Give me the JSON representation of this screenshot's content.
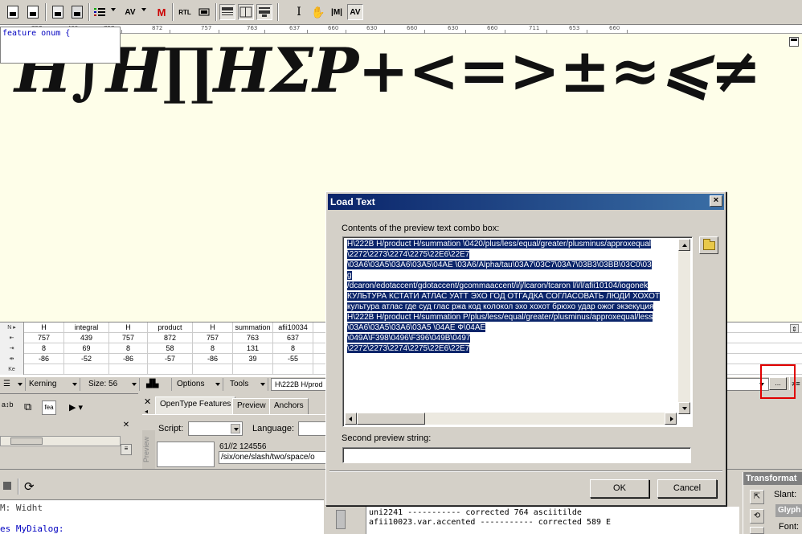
{
  "preview": {
    "glyph_text": "H∫H∏HΣP+<=>±≈⩽≠"
  },
  "ruler": {
    "values": [
      "757",
      "439",
      "757",
      "872",
      "757",
      "763",
      "637",
      "660",
      "630",
      "660",
      "630",
      "660",
      "711",
      "653",
      "660"
    ]
  },
  "metrics": {
    "row_labels": [
      "N ▸",
      "⇤",
      "⇥",
      "⇹",
      "Ke"
    ],
    "columns": [
      {
        "name": "H",
        "advance": "757",
        "lsb": "8",
        "rsb": "-86"
      },
      {
        "name": "integral",
        "advance": "439",
        "lsb": "69",
        "rsb": "-52"
      },
      {
        "name": "H",
        "advance": "757",
        "lsb": "8",
        "rsb": "-86"
      },
      {
        "name": "product",
        "advance": "872",
        "lsb": "58",
        "rsb": "-57"
      },
      {
        "name": "H",
        "advance": "757",
        "lsb": "8",
        "rsb": "-86"
      },
      {
        "name": "summation",
        "advance": "763",
        "lsb": "131",
        "rsb": "39"
      },
      {
        "name": "afii10034",
        "advance": "637",
        "lsb": "8",
        "rsb": "-55"
      }
    ]
  },
  "bar2": {
    "kerning": "Kerning",
    "size": "Size: 56",
    "options": "Options",
    "tools": "Tools",
    "combo_value": "H\\222B H/prod",
    "ellipsis": "...",
    "ne": "≠≡"
  },
  "lower_left": {
    "code_line": "feature onum {"
  },
  "ot_panel": {
    "tabs": [
      "OpenType Features",
      "Preview",
      "Anchors"
    ],
    "script_label": "Script:",
    "language_label": "Language:",
    "side_label": "Preview",
    "value1": "61//2 124556",
    "value2": "/six/one/slash/two/space/o"
  },
  "bottom": {
    "code_lines": [
      "M: Widht",
      "es MyDialog:"
    ],
    "log_lines": [
      "uni2241 ----------- corrected 764 asciitilde",
      "afii10023.var.accented ----------- corrected 589 E"
    ],
    "transform_title": "Transformat",
    "slant_label": "Slant:",
    "glyph_label": "Glyph",
    "font_label": "Font:"
  },
  "dialog": {
    "title": "Load Text",
    "close": "×",
    "label_contents": "Contents of the preview text combo box:",
    "lines": [
      "H\\222B H/product H/summation \\0420/plus/less/equal/greater/plusminus/approxequal",
      "\\2272\\2273\\2274\\2275\\22E6\\22E7",
      "\\03A6\\03A5\\03A6\\03A5\\04AE \\03A6/Alpha/tau\\03A7\\03C7\\03A7\\03B3\\03BB\\03C0\\03",
      "g",
      "/dcaron/edotaccent/gdotaccent/gcommaaccent/i/j/lcaron/tcaron l/i/l/afii10104/iogonek",
      "КУЛЬТУРА КСТАТИ АТЛАС УАТТ ЭХО ГОД ОТГАДКА СОГЛАСОВАТЬ ЛЮДИ ХОХОТ",
      "культура атлас где суд глас ржа код колокол эхо хохот брюхо удар ожог экзекуция",
      "H\\222B H/product H/summation P/plus/less/equal/greater/plusminus/approxequal/less",
      "\\03A6\\03A5\\03A6\\03A5 \\04AE Ф\\04AE",
      "\\049A\\F398\\0496\\F396\\049B\\0497",
      "\\2272\\2273\\2274\\2275\\22E6\\22E7"
    ],
    "label_second": "Second preview string:",
    "second_value": "",
    "ok": "OK",
    "cancel": "Cancel"
  }
}
